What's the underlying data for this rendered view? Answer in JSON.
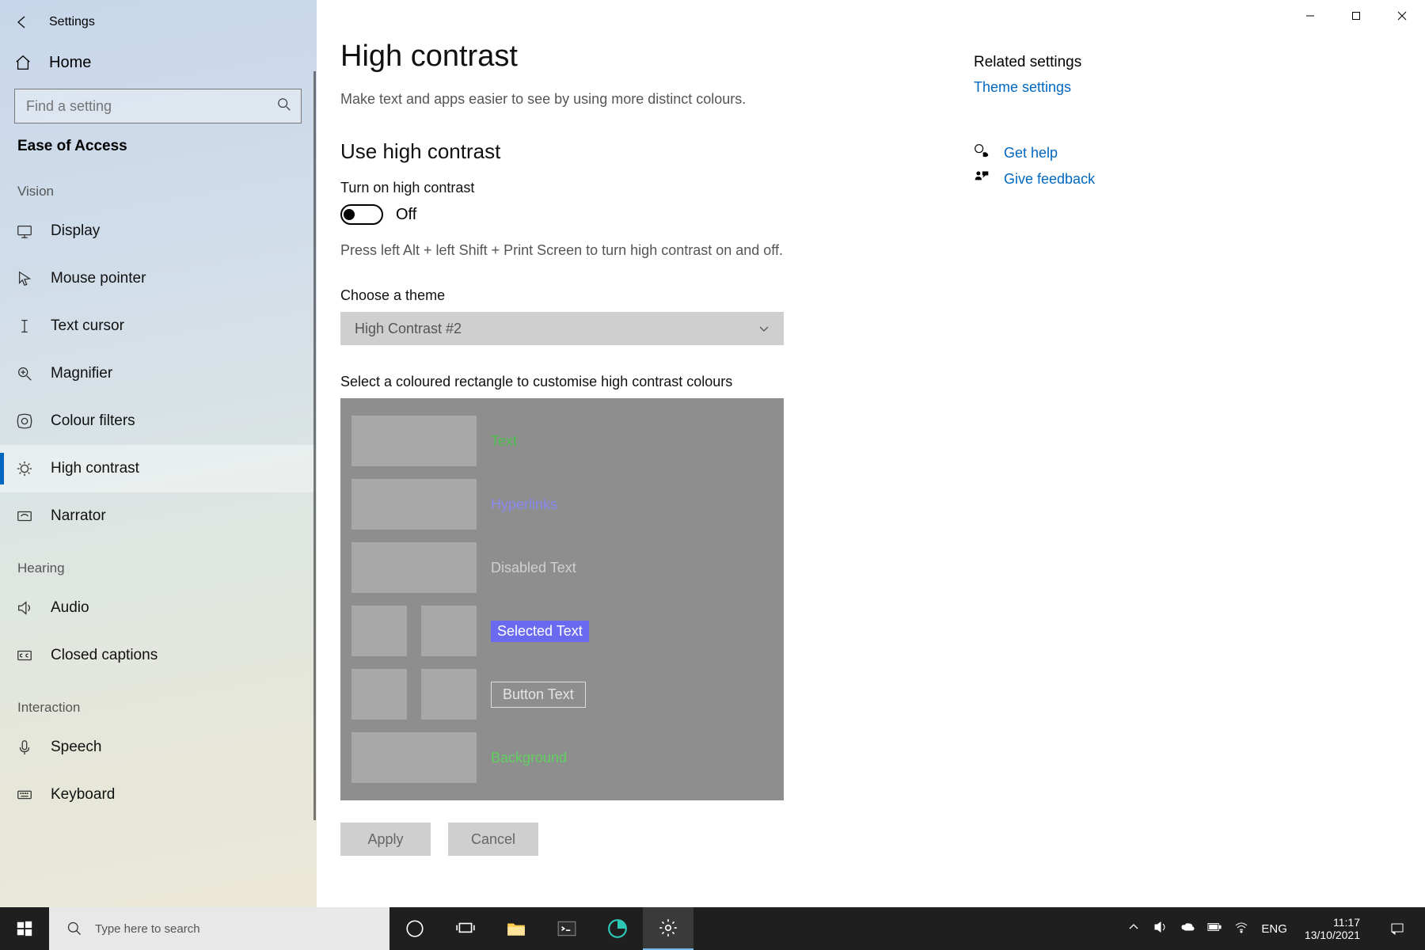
{
  "window": {
    "title": "Settings"
  },
  "sidebar": {
    "home": "Home",
    "search_placeholder": "Find a setting",
    "category": "Ease of Access",
    "groups": [
      {
        "label": "Vision",
        "items": [
          {
            "name": "display",
            "label": "Display"
          },
          {
            "name": "mouse-pointer",
            "label": "Mouse pointer"
          },
          {
            "name": "text-cursor",
            "label": "Text cursor"
          },
          {
            "name": "magnifier",
            "label": "Magnifier"
          },
          {
            "name": "colour-filters",
            "label": "Colour filters"
          },
          {
            "name": "high-contrast",
            "label": "High contrast",
            "selected": true
          },
          {
            "name": "narrator",
            "label": "Narrator"
          }
        ]
      },
      {
        "label": "Hearing",
        "items": [
          {
            "name": "audio",
            "label": "Audio"
          },
          {
            "name": "closed-captions",
            "label": "Closed captions"
          }
        ]
      },
      {
        "label": "Interaction",
        "items": [
          {
            "name": "speech",
            "label": "Speech"
          },
          {
            "name": "keyboard",
            "label": "Keyboard"
          }
        ]
      }
    ]
  },
  "page": {
    "title": "High contrast",
    "subtitle": "Make text and apps easier to see by using more distinct colours.",
    "section_use": "Use high contrast",
    "toggle_label": "Turn on high contrast",
    "toggle_state": "Off",
    "hint": "Press left Alt + left Shift + Print Screen to turn high contrast on and off.",
    "choose_theme_label": "Choose a theme",
    "theme_selected": "High Contrast #2",
    "customise_label": "Select a coloured rectangle to customise high contrast colours",
    "swatches": {
      "text": "Text",
      "hyperlinks": "Hyperlinks",
      "disabled": "Disabled Text",
      "selected": "Selected Text",
      "button": "Button Text",
      "background": "Background"
    },
    "apply": "Apply",
    "cancel": "Cancel"
  },
  "related": {
    "heading": "Related settings",
    "theme_link": "Theme settings",
    "get_help": "Get help",
    "give_feedback": "Give feedback"
  },
  "taskbar": {
    "search_placeholder": "Type here to search",
    "lang": "ENG",
    "time": "11:17",
    "date": "13/10/2021"
  }
}
